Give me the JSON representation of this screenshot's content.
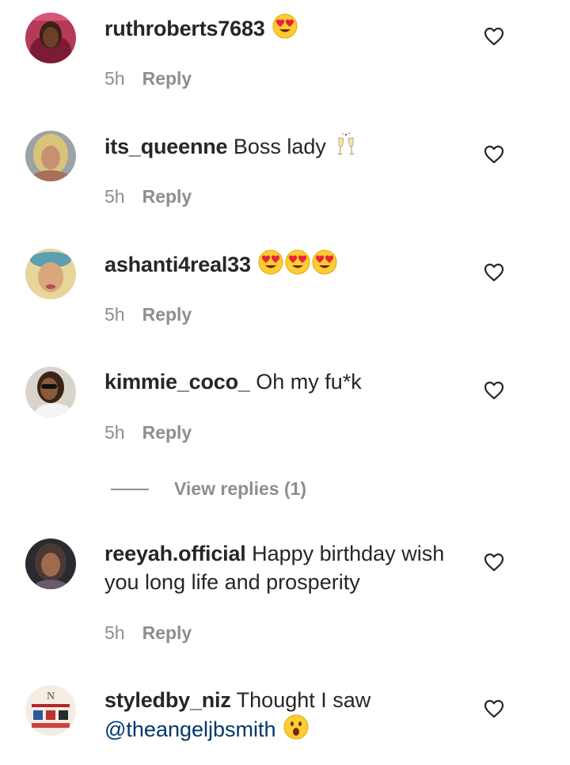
{
  "comments": [
    {
      "username": "ruthroberts7683",
      "text": "",
      "emojis": [
        "heart-eyes-emoji"
      ],
      "time": "5h",
      "reply_label": "Reply"
    },
    {
      "username": "its_queenne",
      "text": "Boss lady",
      "emojis": [
        "clinking-glasses-emoji"
      ],
      "time": "5h",
      "reply_label": "Reply"
    },
    {
      "username": "ashanti4real33",
      "text": "",
      "emojis": [
        "heart-eyes-emoji",
        "heart-eyes-emoji",
        "heart-eyes-emoji"
      ],
      "time": "5h",
      "reply_label": "Reply"
    },
    {
      "username": "kimmie_coco_",
      "text": "Oh my fu*k",
      "emojis": [],
      "time": "5h",
      "reply_label": "Reply",
      "view_replies_label": "View replies (1)"
    },
    {
      "username": "reeyah.official",
      "text": "Happy birthday wish you long life and prosperity",
      "emojis": [],
      "time": "5h",
      "reply_label": "Reply"
    },
    {
      "username": "styledby_niz",
      "text": "Thought I saw",
      "mention": "@theangeljbsmith",
      "emojis": [
        "surprised-face-emoji"
      ],
      "time": "",
      "reply_label": ""
    }
  ],
  "colors": {
    "text": "#262626",
    "secondary": "#8e8e8e",
    "mention": "#00376b",
    "background": "#ffffff"
  },
  "icons": {
    "like": "heart-outline-icon"
  }
}
